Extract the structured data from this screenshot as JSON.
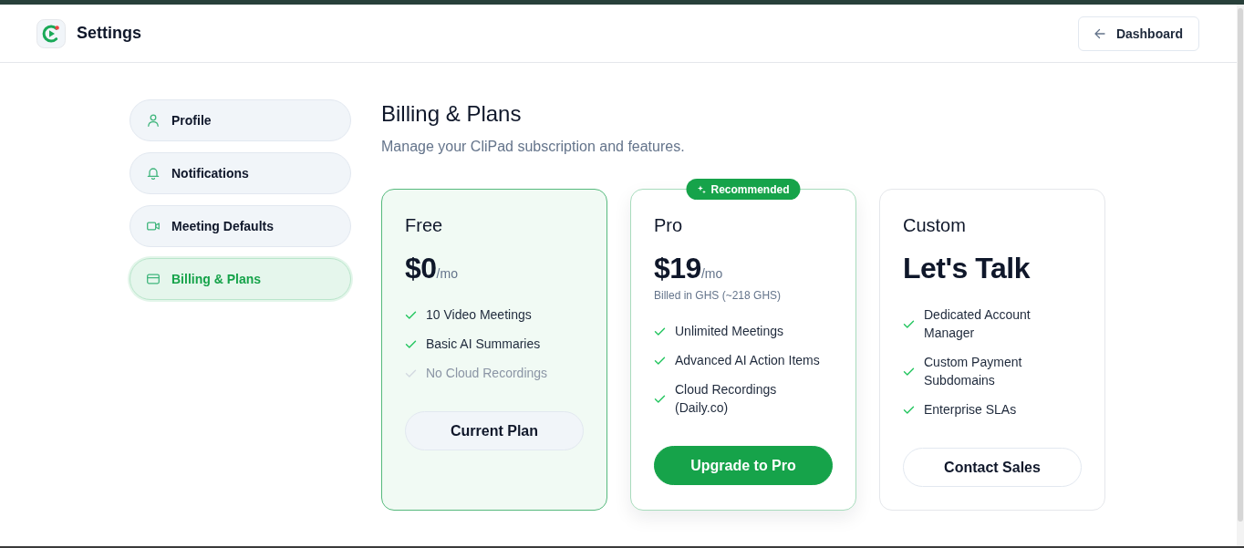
{
  "header": {
    "title": "Settings",
    "back_button": {
      "label": "Dashboard"
    }
  },
  "sidebar": {
    "items": [
      {
        "label": "Profile",
        "kind": "profile",
        "selected": false
      },
      {
        "label": "Notifications",
        "kind": "notifications",
        "selected": false
      },
      {
        "label": "Meeting Defaults",
        "kind": "meetings",
        "selected": false
      },
      {
        "label": "Billing & Plans",
        "kind": "billing",
        "selected": true
      }
    ]
  },
  "page": {
    "title": "Billing & Plans",
    "subtitle": "Manage your CliPad subscription and features."
  },
  "plans": [
    {
      "name": "Free",
      "price": "$0",
      "period": "/mo",
      "current": true,
      "recommended": false,
      "features": [
        {
          "label": "10 Video Meetings",
          "included": true
        },
        {
          "label": "Basic AI Summaries",
          "included": true
        },
        {
          "label": "No Cloud Recordings",
          "included": false
        }
      ],
      "button": {
        "label": "Current Plan",
        "kind": "secondary"
      }
    },
    {
      "name": "Pro",
      "badge": "Recommended",
      "price": "$19",
      "period": "/mo",
      "note": "Billed in GHS (~218 GHS)",
      "current": false,
      "recommended": true,
      "features": [
        {
          "label": "Unlimited Meetings",
          "included": true
        },
        {
          "label": "Advanced AI Action Items",
          "included": true
        },
        {
          "label": "Cloud Recordings (Daily.co)",
          "included": true
        }
      ],
      "button": {
        "label": "Upgrade to Pro",
        "kind": "primary"
      }
    },
    {
      "name": "Custom",
      "price": "Let's Talk",
      "current": false,
      "recommended": false,
      "features": [
        {
          "label": "Dedicated Account Manager",
          "included": true
        },
        {
          "label": "Custom Payment Subdomains",
          "included": true
        },
        {
          "label": "Enterprise SLAs",
          "included": true
        }
      ],
      "button": {
        "label": "Contact Sales",
        "kind": "outline"
      }
    }
  ]
}
